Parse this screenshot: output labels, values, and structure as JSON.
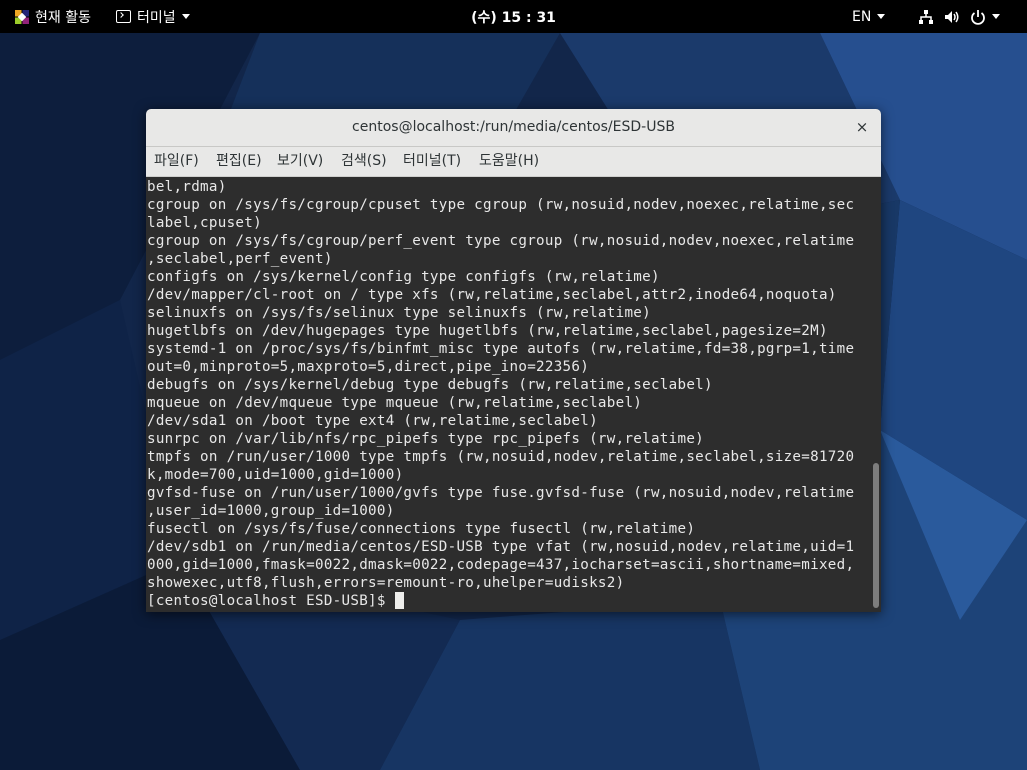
{
  "top_bar": {
    "activities_label": "현재 활동",
    "app_menu_label": "터미널",
    "clock": "(수) 15 : 31",
    "language": "EN",
    "icons": [
      "network-icon",
      "volume-icon",
      "power-icon"
    ]
  },
  "terminal": {
    "title": "centos@localhost:/run/media/centos/ESD-USB",
    "close_label": "×",
    "menu": [
      "파일(F)",
      "편집(E)",
      "보기(V)",
      "검색(S)",
      "터미널(T)",
      "도움말(H)"
    ],
    "lines": [
      "bel,rdma)",
      "cgroup on /sys/fs/cgroup/cpuset type cgroup (rw,nosuid,nodev,noexec,relatime,sec",
      "label,cpuset)",
      "cgroup on /sys/fs/cgroup/perf_event type cgroup (rw,nosuid,nodev,noexec,relatime",
      ",seclabel,perf_event)",
      "configfs on /sys/kernel/config type configfs (rw,relatime)",
      "/dev/mapper/cl-root on / type xfs (rw,relatime,seclabel,attr2,inode64,noquota)",
      "selinuxfs on /sys/fs/selinux type selinuxfs (rw,relatime)",
      "hugetlbfs on /dev/hugepages type hugetlbfs (rw,relatime,seclabel,pagesize=2M)",
      "systemd-1 on /proc/sys/fs/binfmt_misc type autofs (rw,relatime,fd=38,pgrp=1,time",
      "out=0,minproto=5,maxproto=5,direct,pipe_ino=22356)",
      "debugfs on /sys/kernel/debug type debugfs (rw,relatime,seclabel)",
      "mqueue on /dev/mqueue type mqueue (rw,relatime,seclabel)",
      "/dev/sda1 on /boot type ext4 (rw,relatime,seclabel)",
      "sunrpc on /var/lib/nfs/rpc_pipefs type rpc_pipefs (rw,relatime)",
      "tmpfs on /run/user/1000 type tmpfs (rw,nosuid,nodev,relatime,seclabel,size=81720",
      "k,mode=700,uid=1000,gid=1000)",
      "gvfsd-fuse on /run/user/1000/gvfs type fuse.gvfsd-fuse (rw,nosuid,nodev,relatime",
      ",user_id=1000,group_id=1000)",
      "fusectl on /sys/fs/fuse/connections type fusectl (rw,relatime)",
      "/dev/sdb1 on /run/media/centos/ESD-USB type vfat (rw,nosuid,nodev,relatime,uid=1",
      "000,gid=1000,fmask=0022,dmask=0022,codepage=437,iocharset=ascii,shortname=mixed,",
      "showexec,utf8,flush,errors=remount-ro,uhelper=udisks2)"
    ],
    "prompt": "[centos@localhost ESD-USB]$ ",
    "highlight_color": "#d91a1a"
  }
}
